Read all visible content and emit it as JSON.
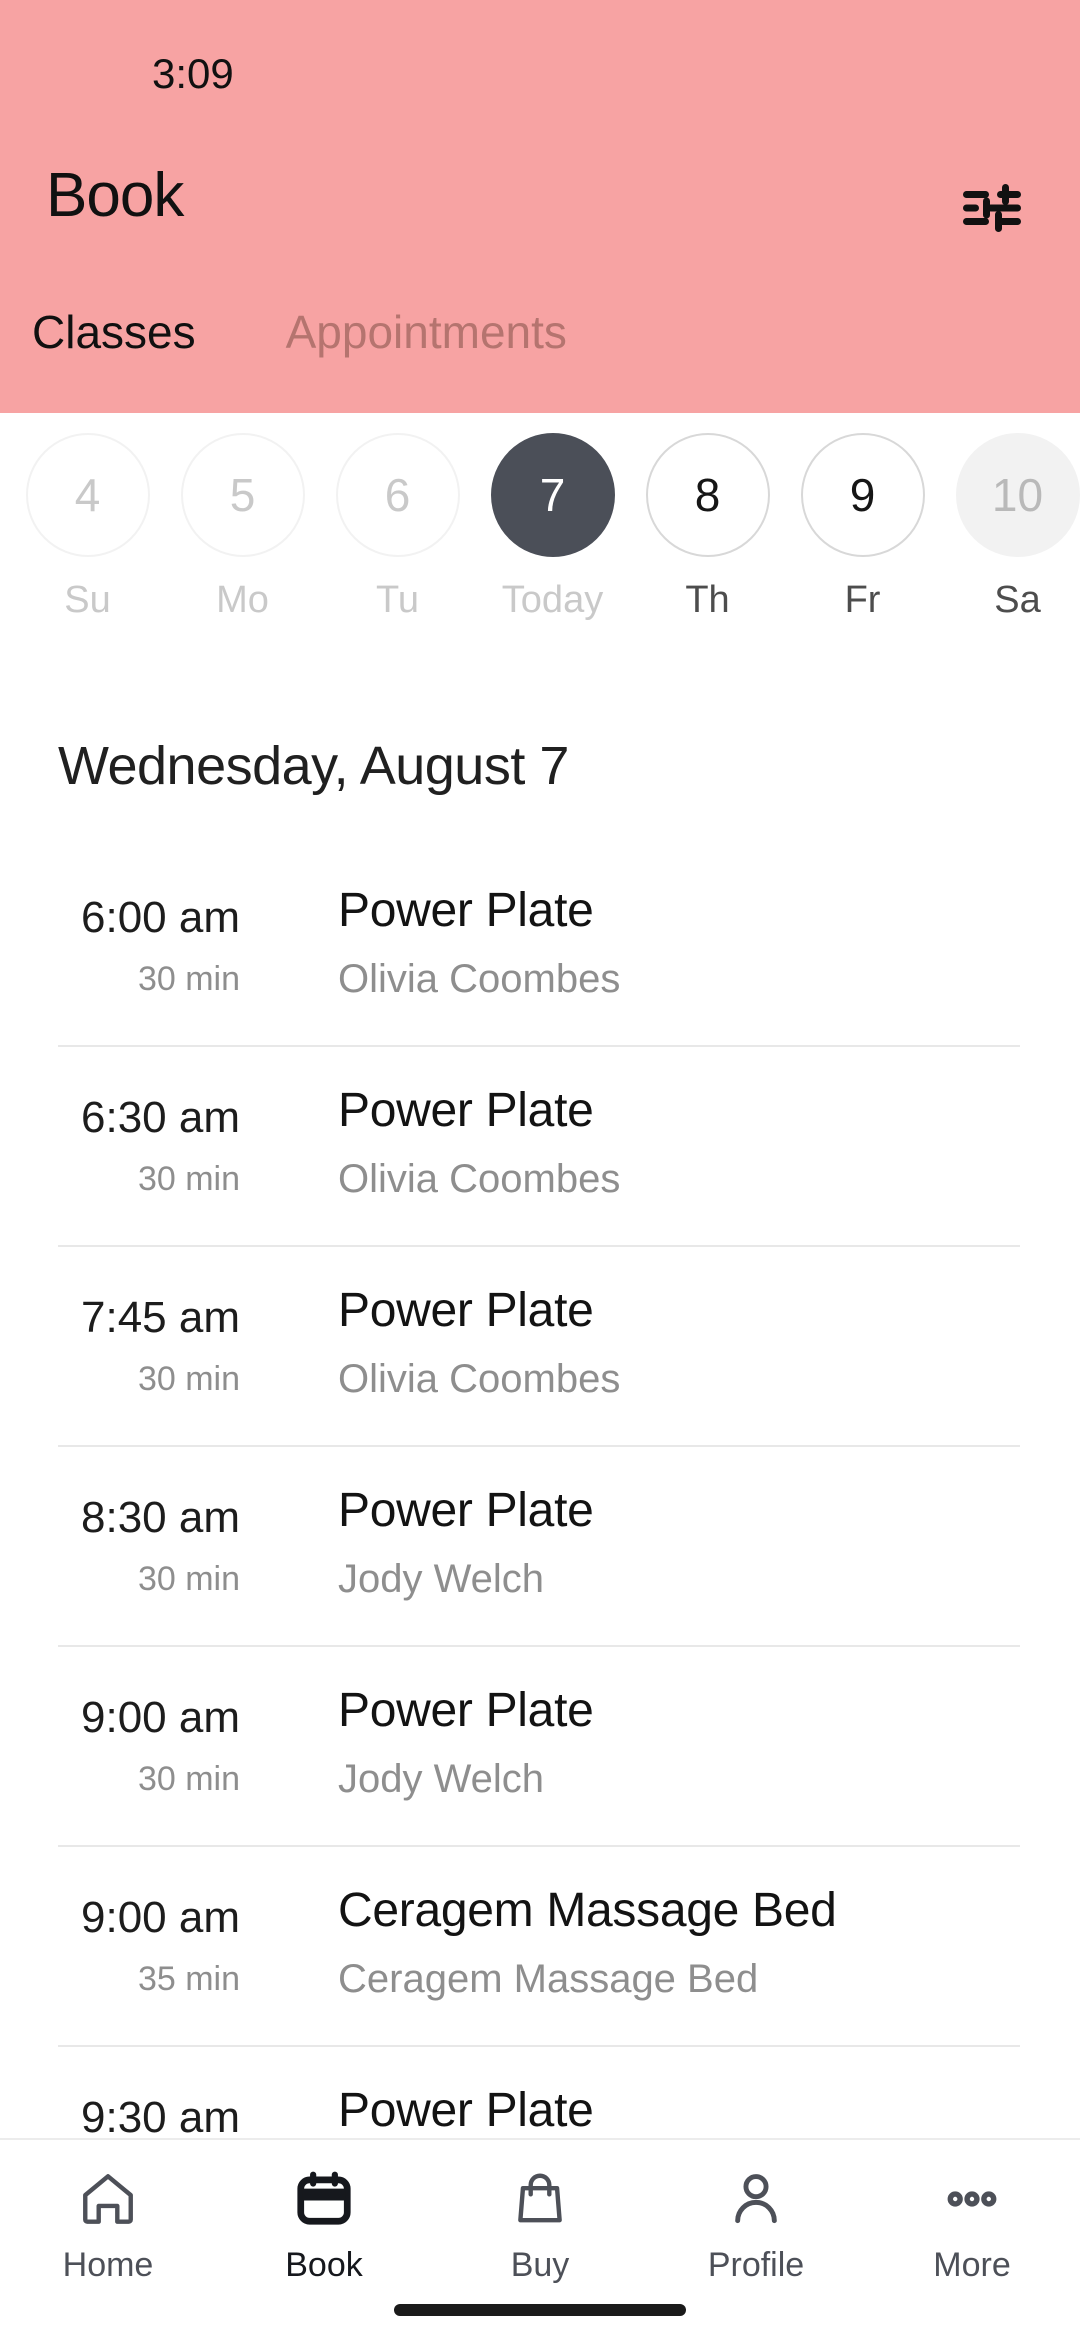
{
  "status_bar": {
    "time": "3:09"
  },
  "header": {
    "title": "Book",
    "background_color": "#f7a3a3",
    "filter_icon": "sliders-filter-icon",
    "tabs": [
      {
        "label": "Classes",
        "active": true
      },
      {
        "label": "Appointments",
        "active": false
      }
    ]
  },
  "date_strip": {
    "days": [
      {
        "date": "4",
        "label": "Su",
        "state": "past"
      },
      {
        "date": "5",
        "label": "Mo",
        "state": "past"
      },
      {
        "date": "6",
        "label": "Tu",
        "state": "past"
      },
      {
        "date": "7",
        "label": "Today",
        "state": "today"
      },
      {
        "date": "8",
        "label": "Th",
        "state": "future"
      },
      {
        "date": "9",
        "label": "Fr",
        "state": "future"
      },
      {
        "date": "10",
        "label": "Sa",
        "state": "dim"
      }
    ]
  },
  "day_heading": "Wednesday, August 7",
  "classes": [
    {
      "time": "6:00 am",
      "duration": "30 min",
      "name": "Power Plate",
      "instructor": "Olivia Coombes"
    },
    {
      "time": "6:30 am",
      "duration": "30 min",
      "name": "Power Plate",
      "instructor": "Olivia Coombes"
    },
    {
      "time": "7:45 am",
      "duration": "30 min",
      "name": "Power Plate",
      "instructor": "Olivia Coombes"
    },
    {
      "time": "8:30 am",
      "duration": "30 min",
      "name": "Power Plate",
      "instructor": "Jody Welch"
    },
    {
      "time": "9:00 am",
      "duration": "30 min",
      "name": "Power Plate",
      "instructor": "Jody Welch"
    },
    {
      "time": "9:00 am",
      "duration": "35 min",
      "name": "Ceragem Massage Bed",
      "instructor": "Ceragem Massage Bed"
    },
    {
      "time": "9:30 am",
      "duration": "",
      "name": "Power Plate",
      "instructor": ""
    }
  ],
  "bottom_nav": {
    "items": [
      {
        "label": "Home",
        "icon": "home-icon",
        "active": false
      },
      {
        "label": "Book",
        "icon": "calendar-icon",
        "active": true
      },
      {
        "label": "Buy",
        "icon": "bag-icon",
        "active": false
      },
      {
        "label": "Profile",
        "icon": "person-icon",
        "active": false
      },
      {
        "label": "More",
        "icon": "dots-icon",
        "active": false
      }
    ]
  }
}
